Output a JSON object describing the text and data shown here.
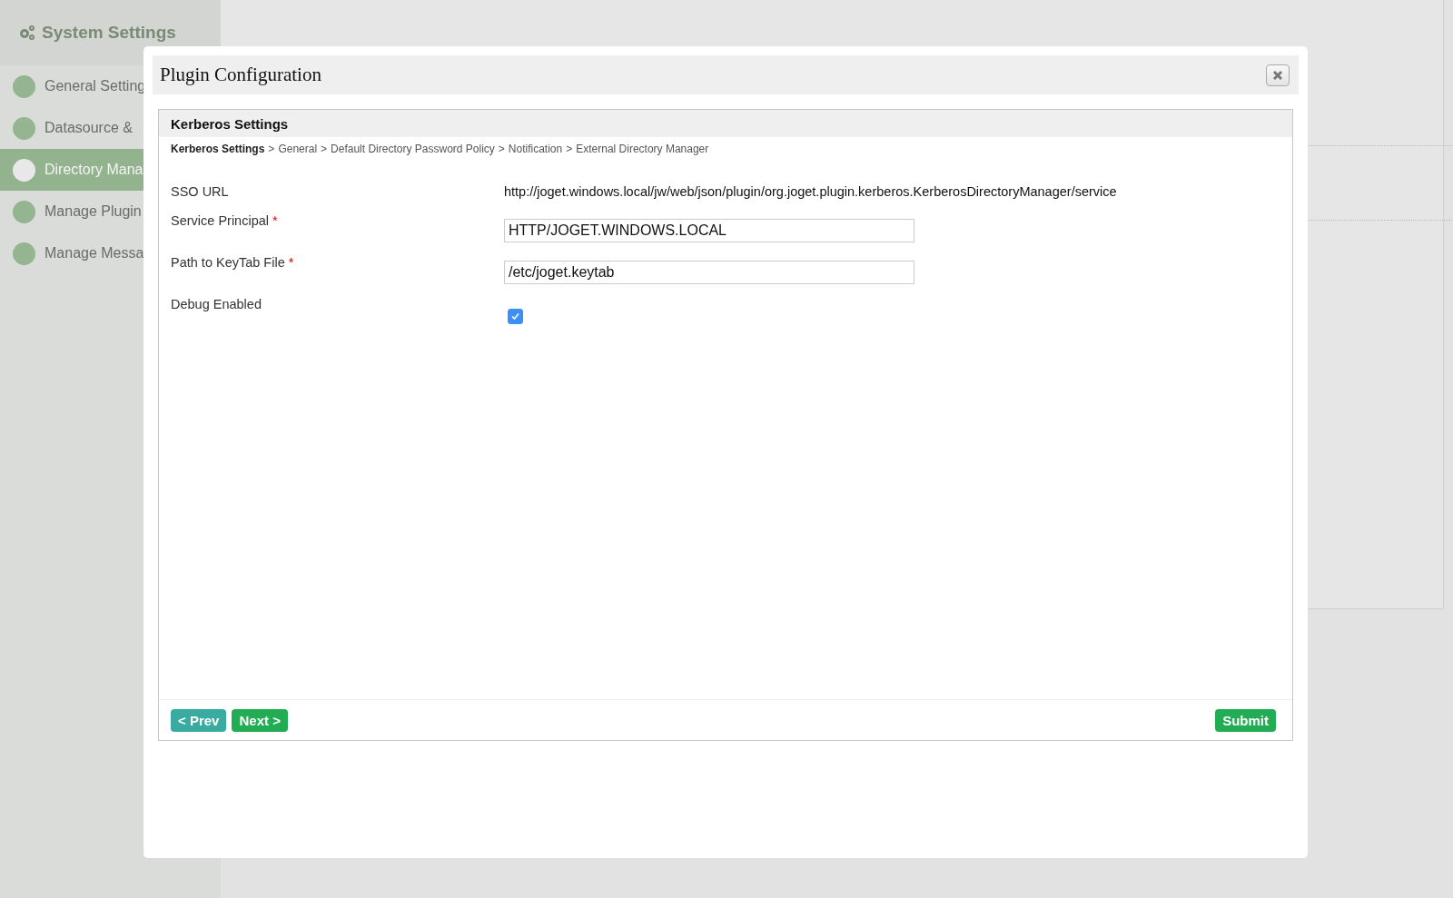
{
  "sidebar": {
    "title": "System Settings",
    "items": [
      {
        "label": "General Setting",
        "selected": false
      },
      {
        "label": "Datasource &",
        "selected": false
      },
      {
        "label": "Directory Mana",
        "selected": true
      },
      {
        "label": "Manage Plugin",
        "selected": false
      },
      {
        "label": "Manage Messa",
        "selected": false
      }
    ]
  },
  "dialog": {
    "title": "Plugin Configuration",
    "panel": {
      "title": "Kerberos Settings",
      "breadcrumb": [
        {
          "label": "Kerberos Settings",
          "selected": true
        },
        {
          "label": "General",
          "selected": false
        },
        {
          "label": "Default Directory Password Policy",
          "selected": false
        },
        {
          "label": "Notification",
          "selected": false
        },
        {
          "label": "External Directory Manager",
          "selected": false
        }
      ],
      "breadcrumb_separator": ">",
      "fields": [
        {
          "kind": "text",
          "label": "SSO URL",
          "required": false,
          "value": "http://joget.windows.local/jw/web/json/plugin/org.joget.plugin.kerberos.KerberosDirectoryManager/service"
        },
        {
          "kind": "input",
          "label": "Service Principal",
          "required": true,
          "value": "HTTP/JOGET.WINDOWS.LOCAL"
        },
        {
          "kind": "input",
          "label": "Path to KeyTab File",
          "required": true,
          "value": "/etc/joget.keytab"
        },
        {
          "kind": "checkbox",
          "label": "Debug Enabled",
          "required": false,
          "checked": true
        }
      ],
      "required_mark": "*",
      "buttons": [
        {
          "kind": "prev",
          "label": "< Prev"
        },
        {
          "kind": "next",
          "label": "Next >"
        },
        {
          "kind": "submit",
          "label": "Submit"
        }
      ]
    }
  }
}
